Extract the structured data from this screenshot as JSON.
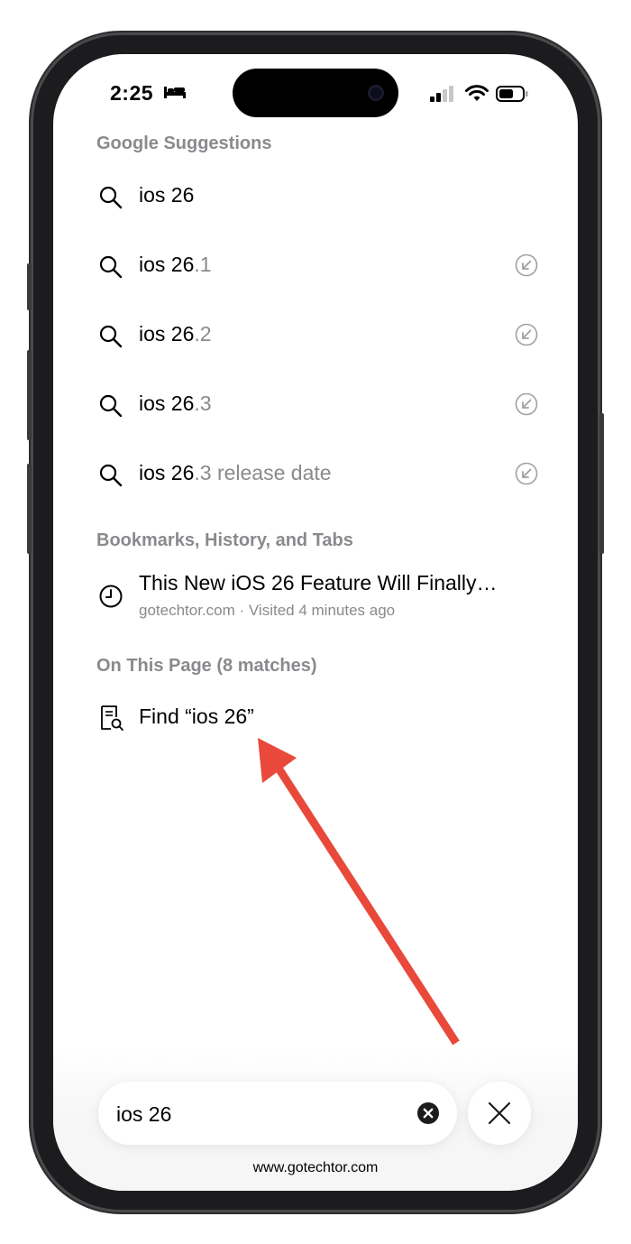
{
  "status_bar": {
    "time": "2:25",
    "sleep_icon": "bed-icon",
    "signal_icon": "cellular-signal-icon",
    "wifi_icon": "wifi-icon",
    "battery_icon": "battery-icon"
  },
  "google_suggestions": {
    "header": "Google Suggestions",
    "items": [
      {
        "typed": "ios 26",
        "completion": ""
      },
      {
        "typed": "ios 26",
        "completion": ".1"
      },
      {
        "typed": "ios 26",
        "completion": ".2"
      },
      {
        "typed": "ios 26",
        "completion": ".3"
      },
      {
        "typed": "ios 26",
        "completion": ".3 release date"
      }
    ]
  },
  "bookmarks": {
    "header": "Bookmarks, History, and Tabs",
    "item": {
      "title": "This New iOS 26 Feature Will Finally…",
      "subtitle": "gotechtor.com · Visited 4 minutes ago"
    }
  },
  "on_page": {
    "header": "On This Page (8 matches)",
    "find_label": "Find “ios 26”"
  },
  "search": {
    "value": "ios 26"
  },
  "watermark": "www.gotechtor.com",
  "colors": {
    "annotation_arrow": "#e8493a",
    "secondary_text": "#8a8a8e"
  }
}
